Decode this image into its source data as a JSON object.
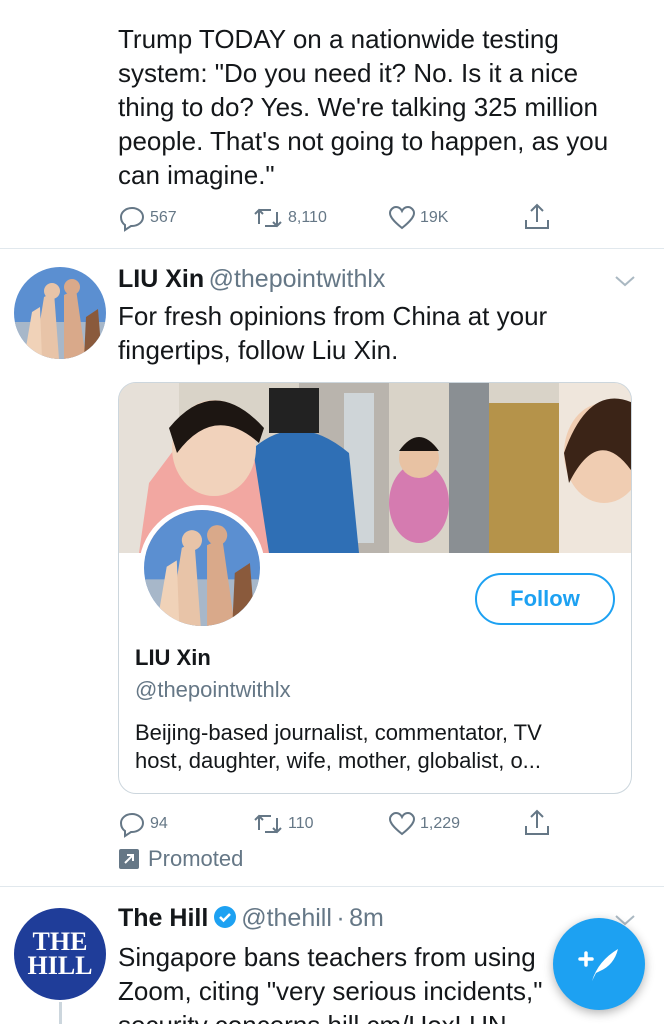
{
  "tweet1": {
    "text_lines": [
      "Trump TODAY on a nationwide testing",
      "system: \"Do you need it? No. Is it a nice",
      "thing to do? Yes. We're talking 325 million",
      "people. That's not going to happen, as you",
      "can imagine.\""
    ],
    "replies": "567",
    "retweets": "8,110",
    "likes": "19K"
  },
  "tweet2": {
    "name": "LIU Xin",
    "handle": "@thepointwithlx",
    "text_lines": [
      "For fresh opinions from China at your",
      "fingertips, follow Liu Xin."
    ],
    "card": {
      "name": "LIU Xin",
      "handle": "@thepointwithlx",
      "bio_lines": [
        "Beijing-based journalist, commentator, TV",
        "host, daughter, wife, mother, globalist, o..."
      ],
      "follow_label": "Follow"
    },
    "replies": "94",
    "retweets": "110",
    "likes": "1,229",
    "promoted_label": "Promoted"
  },
  "tweet3": {
    "name": "The Hill",
    "handle": "@thehill",
    "time_sep": "·",
    "time": "8m",
    "logo_line1": "THE",
    "logo_line2": "HILL",
    "text_lines": [
      "Singapore bans teachers from using",
      "Zoom, citing \"very serious incidents,\"",
      "security concerns hill.cm/UoxLUN"
    ]
  },
  "colors": {
    "accent": "#1da1f2",
    "text_secondary": "#657786",
    "hill_blue": "#1f3d99"
  },
  "icons": [
    "reply-icon",
    "retweet-icon",
    "like-icon",
    "share-icon",
    "chevron-down-icon",
    "promoted-icon",
    "verified-icon",
    "compose-icon"
  ]
}
